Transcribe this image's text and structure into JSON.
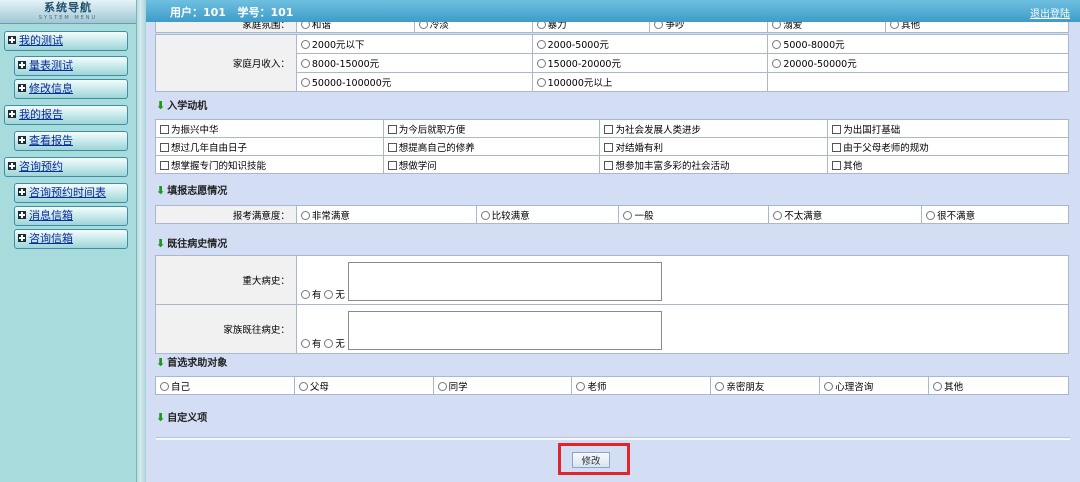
{
  "sidebar": {
    "title": "系统导航",
    "subtitle": "SYSTEM MENU",
    "items": [
      {
        "label": "我的测试",
        "level": 0
      },
      {
        "label": "量表测试",
        "level": 1
      },
      {
        "label": "修改信息",
        "level": 1
      },
      {
        "label": "我的报告",
        "level": 0
      },
      {
        "label": "查看报告",
        "level": 1
      },
      {
        "label": "咨询预约",
        "level": 0
      },
      {
        "label": "咨询预约时间表",
        "level": 1
      },
      {
        "label": "消息信箱",
        "level": 1
      },
      {
        "label": "咨询信箱",
        "level": 1
      }
    ]
  },
  "topbar": {
    "user_info": "用户：101   学号：101",
    "logout": "退出登陆"
  },
  "family": {
    "atmosphere_label": "家庭氛围：",
    "atmosphere_options": [
      "和谐",
      "冷淡",
      "暴力",
      "争吵",
      "溺爱",
      "其他"
    ],
    "income_label": "家庭月收入：",
    "income_options": [
      "2000元以下",
      "2000-5000元",
      "5000-8000元",
      "8000-15000元",
      "15000-20000元",
      "20000-50000元",
      "50000-100000元",
      "100000元以上"
    ]
  },
  "motivation": {
    "heading": "入学动机",
    "options": [
      "为振兴中华",
      "为今后就职方便",
      "为社会发展人类进步",
      "为出国打基础",
      "想过几年自由日子",
      "想提高自己的修养",
      "对结婚有利",
      "由于父母老师的规劝",
      "想掌握专门的知识技能",
      "想做学问",
      "想参加丰富多彩的社会活动",
      "其他"
    ]
  },
  "application": {
    "heading": "填报志愿情况",
    "label": "报考满意度：",
    "options": [
      "非常满意",
      "比较满意",
      "一般",
      "不太满意",
      "很不满意"
    ]
  },
  "history": {
    "heading": "既往病史情况",
    "major_label": "重大病史：",
    "family_label": "家族既往病史：",
    "yes": "有",
    "no": "无"
  },
  "help": {
    "heading": "首选求助对象",
    "options": [
      "自己",
      "父母",
      "同学",
      "老师",
      "亲密朋友",
      "心理咨询",
      "其他"
    ]
  },
  "custom": {
    "heading": "自定义项"
  },
  "save_button": "修改",
  "colors": {
    "topbar": "#4aa8d4",
    "main_bg": "#d3ddf3",
    "sidebar_bg": "#a8dcdc",
    "nav_text": "#0b2a9c",
    "section_arrow": "#1a9a1a",
    "highlight": "#e0262a"
  }
}
